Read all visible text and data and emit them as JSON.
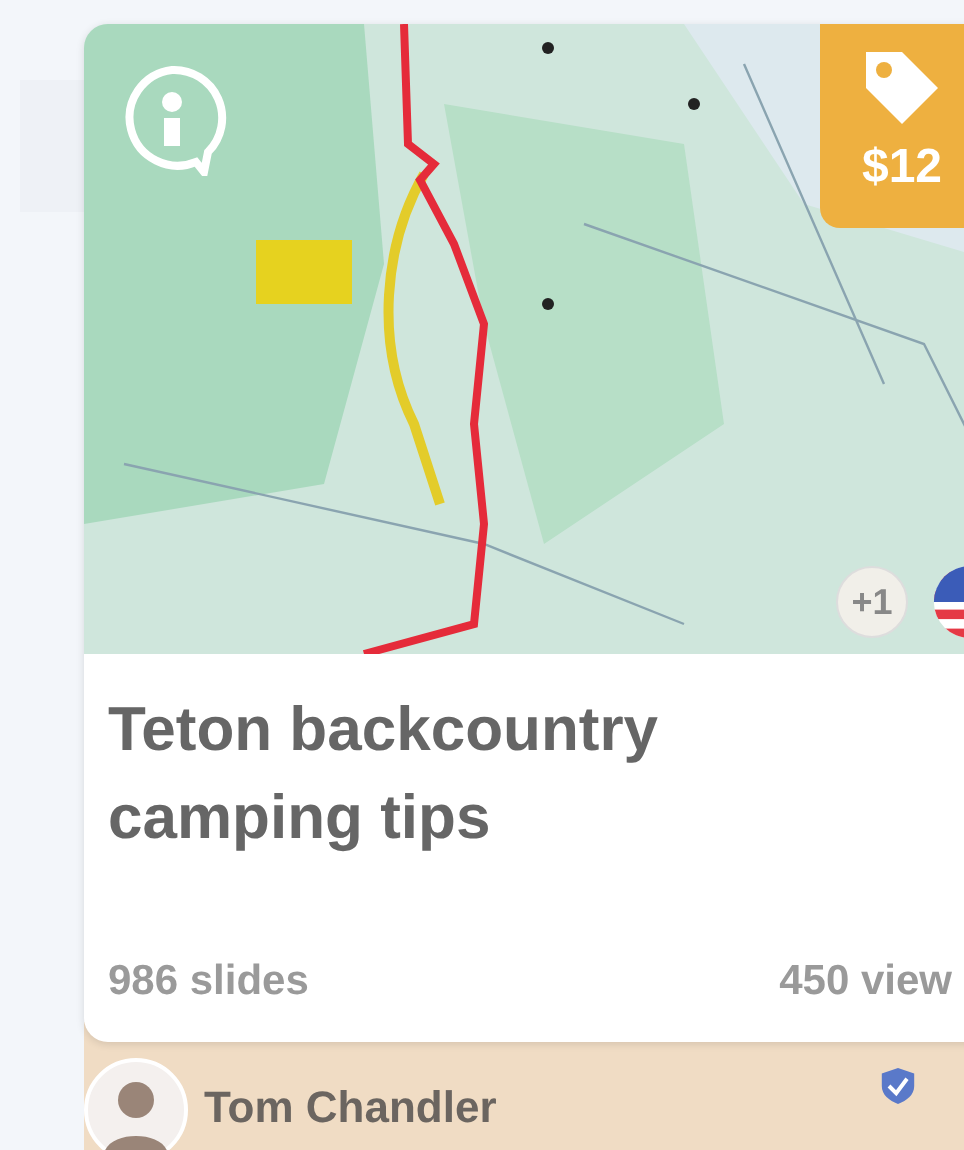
{
  "card": {
    "price": "$12",
    "extra_count": "+1",
    "title": "Teton backcountry camping tips",
    "slides": "986 slides",
    "views": "450 view"
  },
  "author": {
    "name": "Tom Chandler",
    "verified": true
  }
}
